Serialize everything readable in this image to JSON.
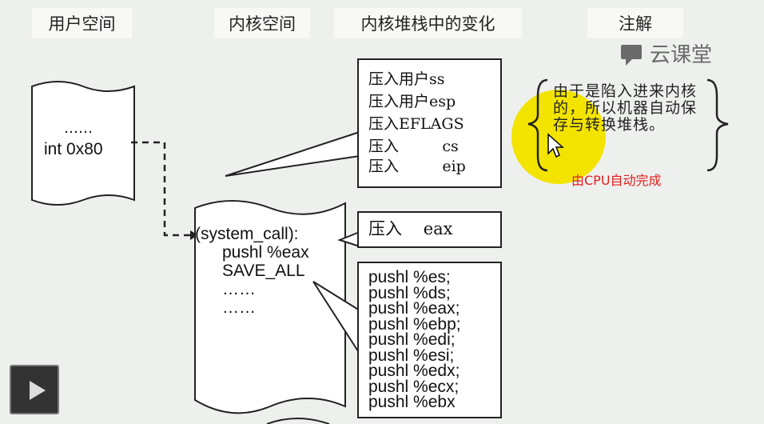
{
  "headers": [
    "用户空间",
    "内核空间",
    "内核堆栈中的变化",
    "注解"
  ],
  "user_page": {
    "dots": "……",
    "instr": "int 0x80"
  },
  "kernel_page": {
    "lines": [
      "(system_call):",
      "pushl %eax",
      "SAVE_ALL",
      "……",
      "……"
    ]
  },
  "stack_box1": {
    "lines": [
      "压入用户ss",
      "压入用户esp",
      "压入EFLAGS",
      "压入         cs",
      "压入         eip"
    ]
  },
  "stack_box2": {
    "line": "压入    eax"
  },
  "stack_box3": {
    "lines": [
      "pushl %es;",
      "pushl %ds;",
      "pushl %eax;",
      "pushl %ebp;",
      "pushl %edi;",
      "pushl %esi;",
      "pushl %edx;",
      "pushl %ecx;",
      "pushl %ebx"
    ]
  },
  "annotation": {
    "text": "由于是陷入进来内核的，所以机器自动保存与转换堆栈。",
    "note": "由CPU自动完成",
    "note_color": "#e02020",
    "highlight_color": "#f3e400"
  },
  "brand": {
    "name": "云课堂"
  },
  "icons": {
    "play": "play-icon",
    "brand": "cloud-classroom-icon",
    "cursor": "mouse-cursor-icon"
  }
}
